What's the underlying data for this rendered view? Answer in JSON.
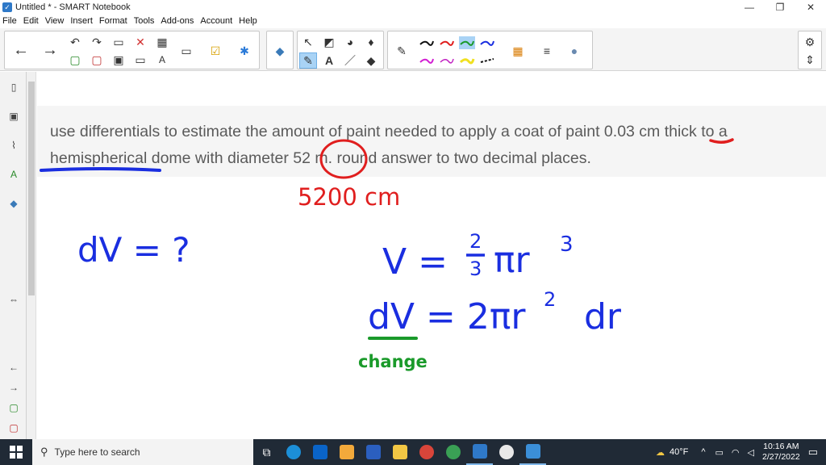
{
  "window": {
    "title": "Untitled * - SMART Notebook",
    "minimize": "—",
    "restore": "❐",
    "close": "✕"
  },
  "menu": [
    "File",
    "Edit",
    "View",
    "Insert",
    "Format",
    "Tools",
    "Add-ons",
    "Account",
    "Help"
  ],
  "question": {
    "text": "use differentials to estimate the amount of paint needed to apply a coat of paint 0.03 cm thick to a hemispherical dome with diameter 52 m. round answer to two decimal places."
  },
  "handwriting": {
    "conversion": "5200 cm",
    "unknown": "dV = ?",
    "volume": "V = 2/3 πr³",
    "differential": "dV = 2πr² dr",
    "note": "change"
  },
  "ink_colors": {
    "blue": "#1a2ee0",
    "red": "#e01e1e",
    "green": "#1a9a2a"
  },
  "taskbar": {
    "search_placeholder": "Type here to search",
    "weather": "40°F",
    "time": "10:16 AM",
    "date": "2/27/2022"
  },
  "icons": [
    "back-icon",
    "forward-icon",
    "undo-icon",
    "redo-icon",
    "save-icon",
    "delete-icon",
    "table-icon",
    "screen-capture-icon",
    "add-ons-icon",
    "select-icon",
    "text-icon",
    "pen-icon",
    "eraser-icon",
    "settings-icon"
  ]
}
